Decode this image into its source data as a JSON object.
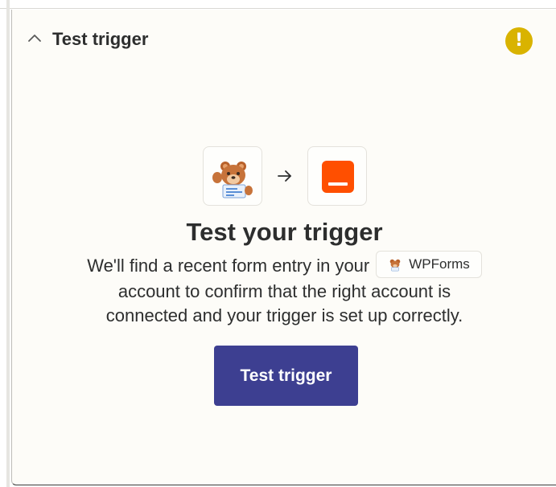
{
  "header": {
    "title": "Test trigger",
    "collapse_icon": "chevron-up-icon",
    "status_icon": "warning-icon",
    "status_icon_glyph": "!",
    "status_color": "#d9b300"
  },
  "flow": {
    "source_app_icon": "wpforms-bear-icon",
    "arrow_icon": "arrow-right-icon",
    "destination_app_icon": "zapier-orange-icon",
    "destination_color": "#ff4f00"
  },
  "main": {
    "title": "Test your trigger",
    "description_line1": "We'll find a recent form entry in your",
    "app_chip_label": "WPForms",
    "description_line2": "account to confirm that the right account is",
    "description_line3": "connected and your trigger is set up correctly."
  },
  "actions": {
    "test_button_label": "Test trigger",
    "test_button_color": "#3d3f91"
  }
}
